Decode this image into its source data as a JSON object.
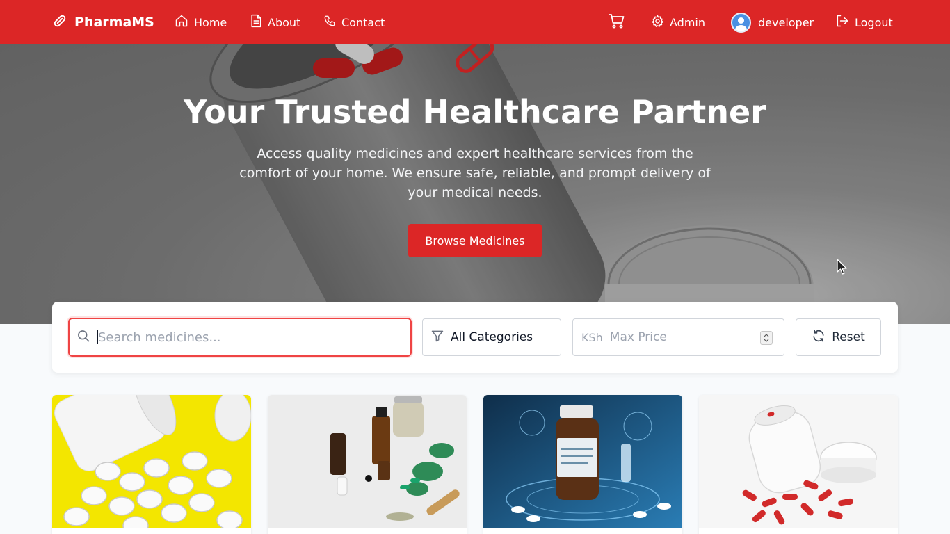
{
  "navbar": {
    "brand": "PharmaMS",
    "links": [
      {
        "label": "Home",
        "icon": "home-icon"
      },
      {
        "label": "About",
        "icon": "document-icon"
      },
      {
        "label": "Contact",
        "icon": "phone-icon"
      }
    ],
    "cart_icon": "cart-icon",
    "admin_label": "Admin",
    "user_label": "developer",
    "logout_label": "Logout"
  },
  "hero": {
    "title": "Your Trusted Healthcare Partner",
    "subtitle": "Access quality medicines and expert healthcare services from the comfort of your home. We ensure safe, reliable, and prompt delivery of your medical needs.",
    "cta_label": "Browse Medicines"
  },
  "filters": {
    "search_placeholder": "Search medicines...",
    "search_value": "",
    "category_selected": "All Categories",
    "currency": "KSh",
    "max_price_placeholder": "Max Price",
    "reset_label": "Reset"
  },
  "products": [
    {
      "image": "white-pills-on-yellow"
    },
    {
      "image": "herbal-bottles-and-capsules"
    },
    {
      "image": "futuristic-medicine-bottle"
    },
    {
      "image": "pill-jar-with-red-capsules"
    }
  ],
  "colors": {
    "primary": "#dc2626",
    "background": "#f8fafc",
    "focus_border": "#ef4444"
  }
}
